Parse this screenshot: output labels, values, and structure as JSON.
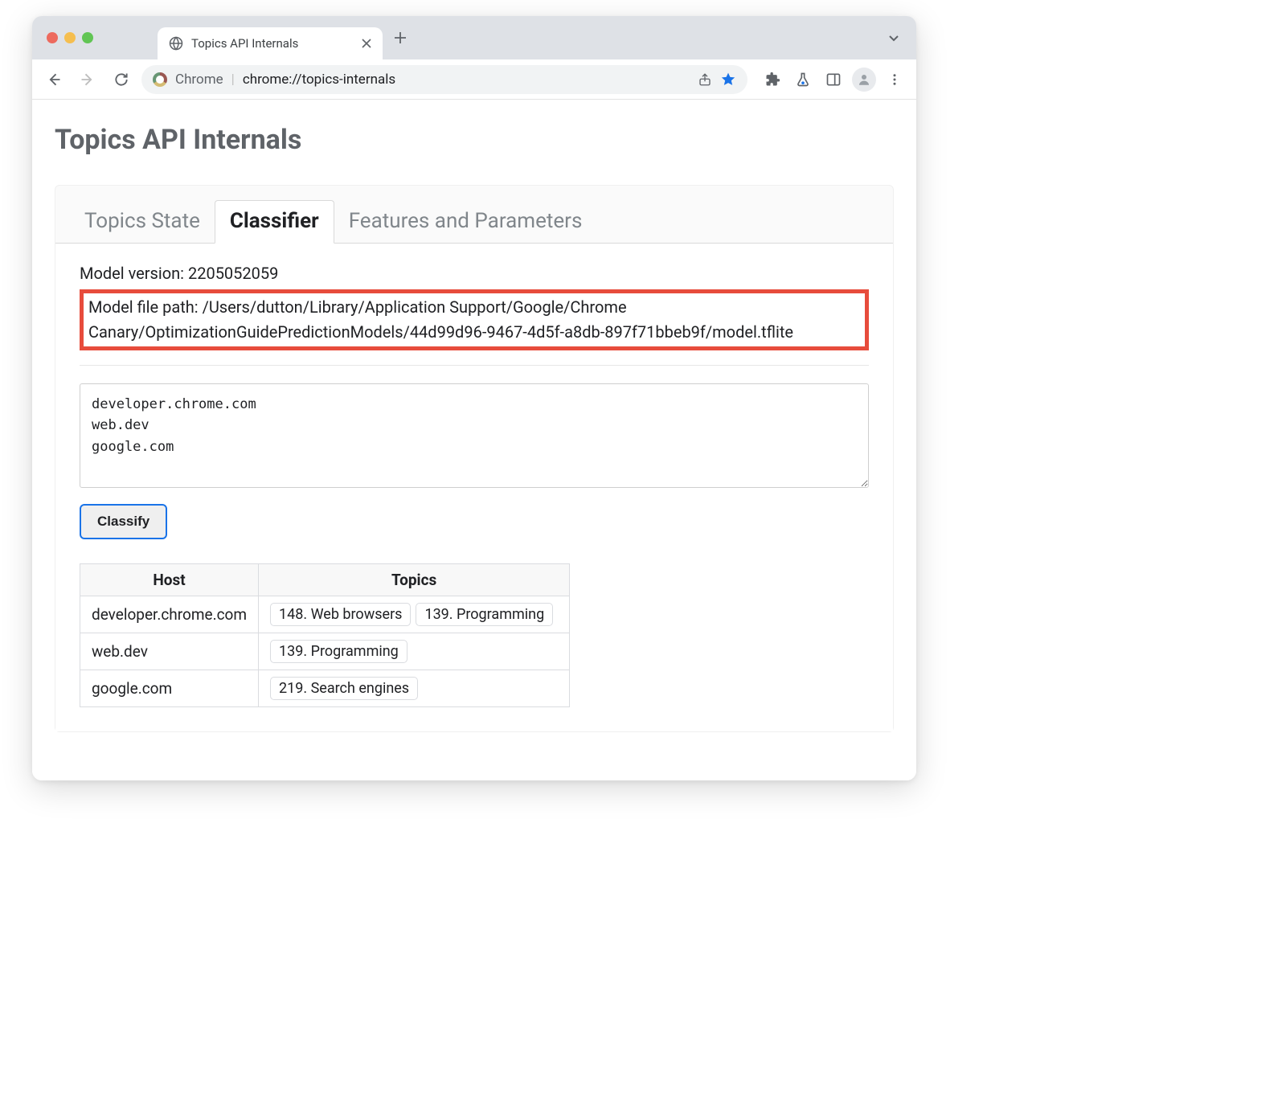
{
  "browser": {
    "tab_title": "Topics API Internals",
    "omnibox_label": "Chrome",
    "url": "chrome://topics-internals"
  },
  "page": {
    "title": "Topics API Internals",
    "tabs": [
      {
        "label": "Topics State"
      },
      {
        "label": "Classifier"
      },
      {
        "label": "Features and Parameters"
      }
    ],
    "active_tab_index": 1,
    "classifier": {
      "model_version_label": "Model version:",
      "model_version": "2205052059",
      "model_path_label": "Model file path:",
      "model_path": "/Users/dutton/Library/Application Support/Google/Chrome Canary/OptimizationGuidePredictionModels/44d99d96-9467-4d5f-a8db-897f71bbeb9f/model.tflite",
      "hosts_input": "developer.chrome.com\nweb.dev\ngoogle.com",
      "classify_button": "Classify",
      "table_headers": {
        "host": "Host",
        "topics": "Topics"
      },
      "results": [
        {
          "host": "developer.chrome.com",
          "topics": [
            "148. Web browsers",
            "139. Programming"
          ]
        },
        {
          "host": "web.dev",
          "topics": [
            "139. Programming"
          ]
        },
        {
          "host": "google.com",
          "topics": [
            "219. Search engines"
          ]
        }
      ]
    }
  }
}
